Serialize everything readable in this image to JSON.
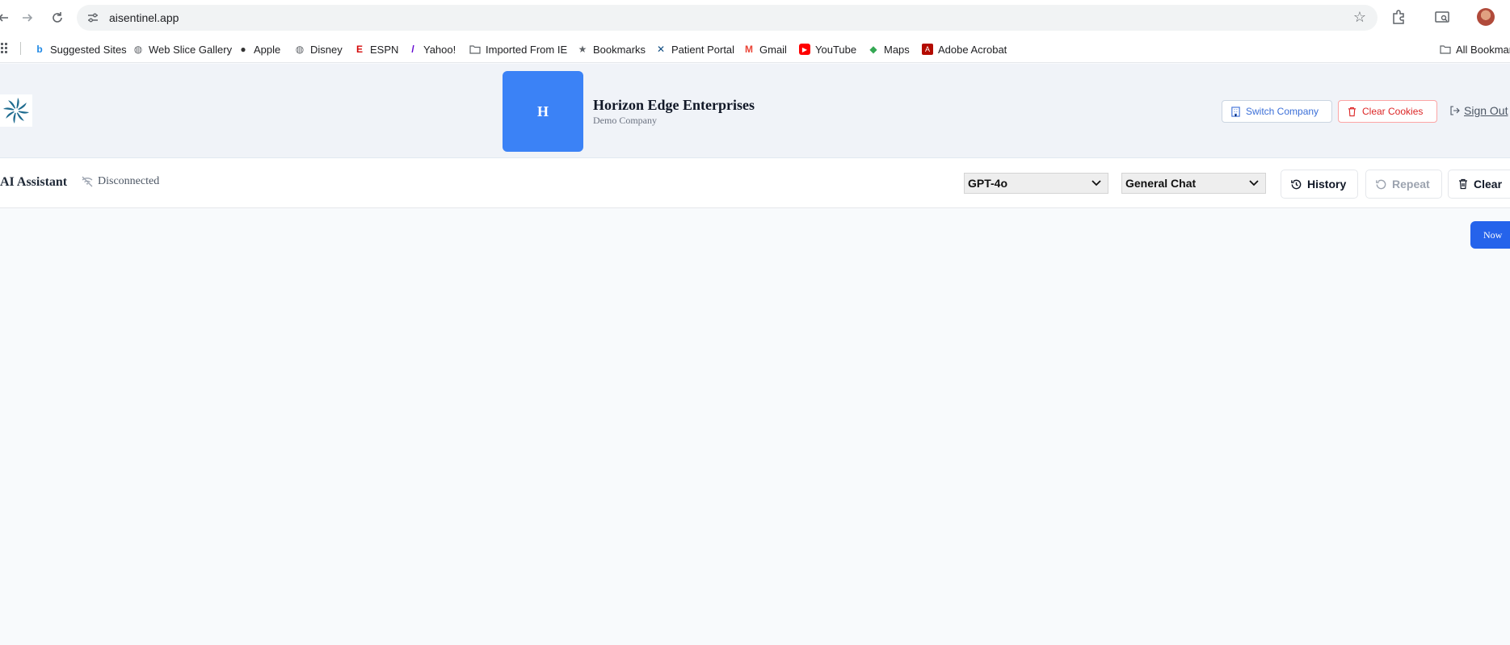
{
  "browser": {
    "url": "aisentinel.app",
    "bookmarks": [
      {
        "label": "Suggested Sites",
        "icon": "bing-icon"
      },
      {
        "label": "Web Slice Gallery",
        "icon": "globe-icon"
      },
      {
        "label": "Apple",
        "icon": "apple-icon"
      },
      {
        "label": "Disney",
        "icon": "globe-icon"
      },
      {
        "label": "ESPN",
        "icon": "espn-icon"
      },
      {
        "label": "Yahoo!",
        "icon": "yahoo-icon"
      },
      {
        "label": "Imported From IE",
        "icon": "folder-icon"
      },
      {
        "label": "Bookmarks",
        "icon": "star-icon"
      },
      {
        "label": "Patient Portal",
        "icon": "x-icon"
      },
      {
        "label": "Gmail",
        "icon": "gmail-icon"
      },
      {
        "label": "YouTube",
        "icon": "youtube-icon"
      },
      {
        "label": "Maps",
        "icon": "maps-icon"
      },
      {
        "label": "Adobe Acrobat",
        "icon": "acrobat-icon"
      }
    ],
    "all_bookmarks": "All Bookmarks"
  },
  "header": {
    "company_initial": "H",
    "company_name": "Horizon Edge Enterprises",
    "company_subtitle": "Demo Company",
    "switch_company": "Switch Company",
    "clear_cookies": "Clear Cookies",
    "sign_out": "Sign Out"
  },
  "assistant": {
    "title": "AI Assistant",
    "status": "Disconnected",
    "model": "GPT-4o",
    "mode": "General Chat",
    "history": "History",
    "repeat": "Repeat",
    "clear": "Clear"
  },
  "chat": {
    "message_time": "Now"
  },
  "colors": {
    "accent": "#3b82f6",
    "bubble": "#2563eb",
    "danger": "#dc2626"
  }
}
